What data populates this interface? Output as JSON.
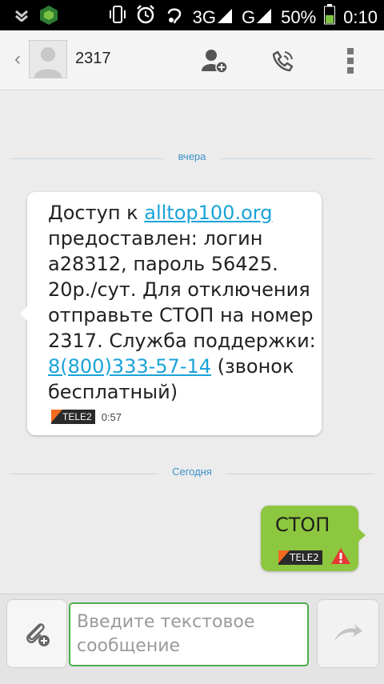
{
  "statusbar": {
    "network_3g": "3G",
    "network_g": "G",
    "battery": "50%",
    "time": "0:10",
    "icons": [
      "usb-icon",
      "shield-app-icon",
      "vibrate-icon",
      "alarm-icon",
      "power-saver-icon",
      "signal-3g-icon",
      "signal-g-icon",
      "battery-icon"
    ]
  },
  "toolbar": {
    "contact_name": "2317",
    "icons": [
      "back-chevron-icon",
      "contact-avatar-icon",
      "add-contact-icon",
      "call-icon",
      "overflow-menu-icon"
    ]
  },
  "separators": {
    "yesterday": "вчера",
    "today": "Сегодня"
  },
  "incoming": {
    "line1_prefix": "Доступ к ",
    "link_site": "alltop100.org",
    "line2": "предоставлен: логин",
    "line3": "a28312, пароль 56425.",
    "line4": "20р./сут. Для отключения",
    "line5": "отправьте СТОП на номер",
    "line6": "2317. Служба поддержки:",
    "link_phone": "8(800)333-57-14",
    "line7_suffix": " (звонок",
    "line8": "бесплатный)",
    "carrier": "TELE2",
    "time": "0:57"
  },
  "outgoing": {
    "text": "СТОП",
    "carrier": "TELE2",
    "status_icon": "error-warning-icon"
  },
  "compose": {
    "placeholder": "Введите текстовое сообщение",
    "value": ""
  },
  "colors": {
    "link": "#1aa3d8",
    "separator_text": "#3b93c9",
    "outgoing_bubble": "#8dc63f",
    "input_border": "#4cae4c",
    "warning": "#e53935",
    "carrier_orange": "#f26b21"
  }
}
